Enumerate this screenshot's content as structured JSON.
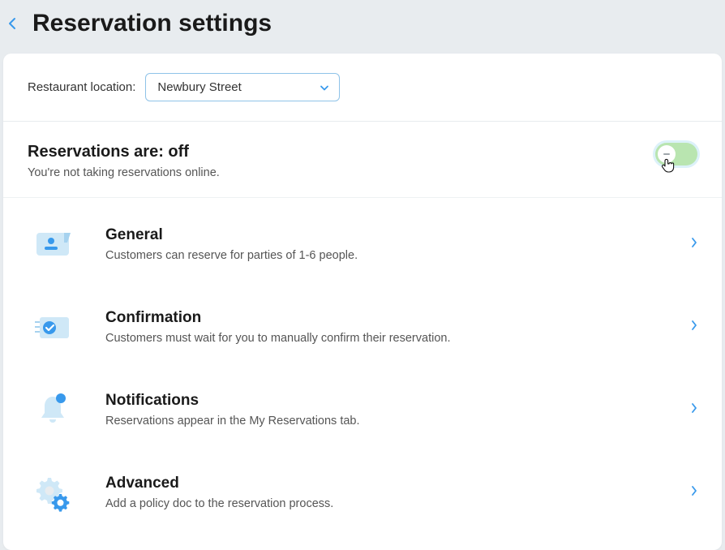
{
  "header": {
    "title": "Reservation settings"
  },
  "location": {
    "label": "Restaurant location:",
    "selected": "Newbury Street"
  },
  "status": {
    "title": "Reservations are: off",
    "description": "You're not taking reservations online."
  },
  "items": [
    {
      "title": "General",
      "description": "Customers can reserve for parties of 1-6 people."
    },
    {
      "title": "Confirmation",
      "description": "Customers must wait for you to manually confirm their reservation."
    },
    {
      "title": "Notifications",
      "description": "Reservations appear in the My Reservations tab."
    },
    {
      "title": "Advanced",
      "description": "Add a policy doc to the reservation process."
    }
  ]
}
